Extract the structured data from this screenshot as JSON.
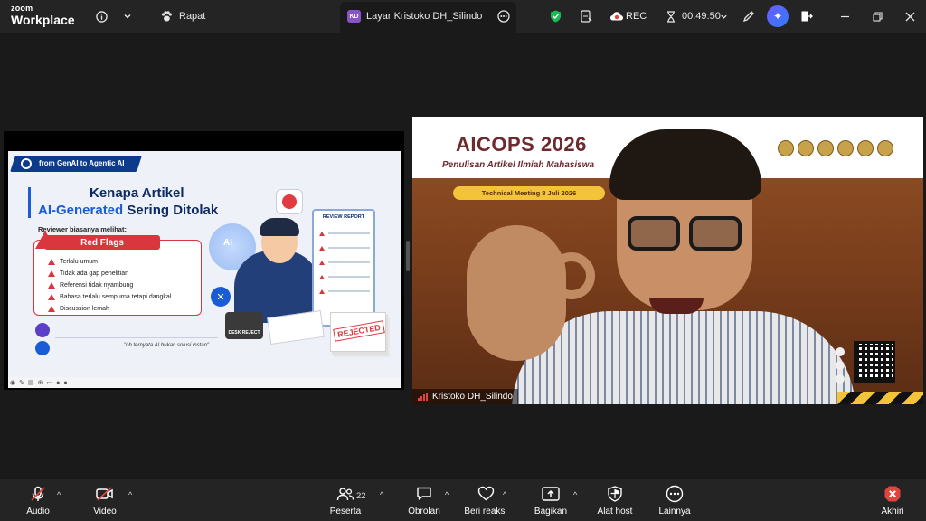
{
  "app": {
    "brand_top": "zoom",
    "brand_bottom": "Workplace"
  },
  "topbar": {
    "meeting_tab": "Rapat",
    "share_tab": "Layar Kristoko DH_Silindo",
    "share_badge": "KD",
    "rec_label": "REC",
    "timer": "00:49:50"
  },
  "slide": {
    "banner": "from GenAI to Agentic AI",
    "title_line1": "Kenapa Artikel",
    "title_highlight": "AI-Generated",
    "title_rest": " Sering Ditolak",
    "reviewer_label": "Reviewer biasanya melihat:",
    "red_flags_title": "Red Flags",
    "red_flags": [
      "Terlalu umum",
      "Tidak ada gap penelitian",
      "Referensi tidak nyambung",
      "Bahasa terlalu sempurna tetapi dangkal",
      "Discussion lemah"
    ],
    "ai_badge": "AI",
    "review_report": "REVIEW REPORT",
    "desk_reject": "DESK REJECT",
    "rejected": "REJECTED",
    "quote": "\"oh ternyata AI bukan solusi instan\"."
  },
  "video": {
    "event_title": "AICOPS 2026",
    "event_subtitle": "Penulisan Artikel Ilmiah Mahasiswa",
    "meeting_pill": "Technical Meeting 8 Juli 2026",
    "participant_name": "Kristoko DH_Silindo"
  },
  "toolbar": {
    "audio": "Audio",
    "video": "Video",
    "participants": "Peserta",
    "participants_count": "22",
    "chat": "Obrolan",
    "react": "Beri reaksi",
    "share": "Bagikan",
    "host_tools": "Alat host",
    "more": "Lainnya",
    "end": "Akhiri"
  },
  "colors": {
    "accent_ai": "#6b5cff",
    "record_red": "#e0443f",
    "shield_green": "#1db954",
    "end_red": "#e0443f"
  }
}
